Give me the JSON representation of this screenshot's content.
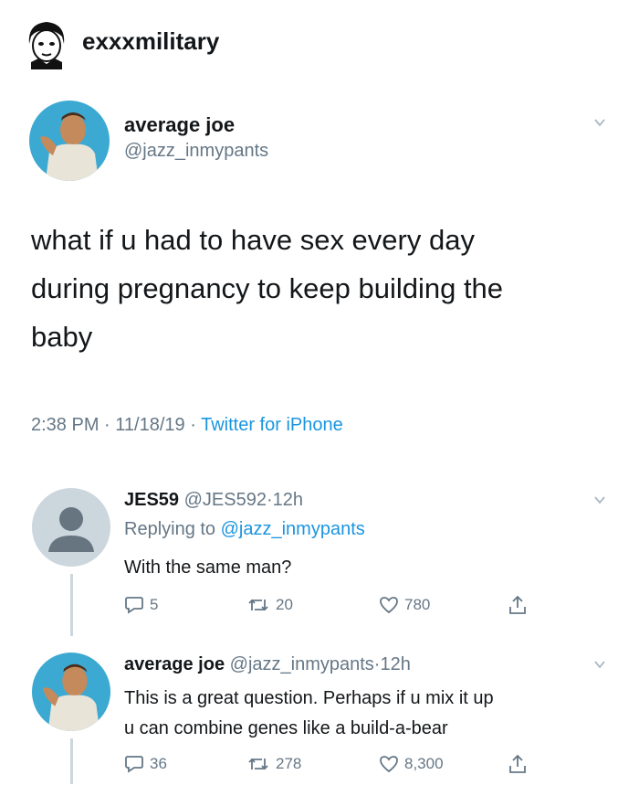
{
  "poster": {
    "username": "exxxmilitary",
    "avatar_icon": "cartoon-face-icon"
  },
  "main_tweet": {
    "display_name": "average joe",
    "handle": "@jazz_inmypants",
    "text_lines": [
      "what if u had to have sex every day",
      "during pregnancy to keep building the",
      "baby"
    ],
    "time": "2:38 PM",
    "date": "11/18/19",
    "source": "Twitter for iPhone",
    "dot": "·"
  },
  "replies": [
    {
      "display_name": "JES59",
      "handle": "@JES592",
      "age": "12h",
      "replying_prefix": "Replying to",
      "replying_to": "@jazz_inmypants",
      "text_lines": [
        "With the same man?"
      ],
      "counts": {
        "replies": "5",
        "retweets": "20",
        "likes": "780"
      }
    },
    {
      "display_name": "average joe",
      "handle": "@jazz_inmypants",
      "age": "12h",
      "text_lines": [
        "This is a great question. Perhaps if u mix it up",
        "u can combine genes like a build-a-bear"
      ],
      "counts": {
        "replies": "36",
        "retweets": "278",
        "likes": "8,300"
      }
    }
  ],
  "colors": {
    "link": "#1b95e0",
    "muted": "#657786",
    "avatar_bg": "#3ba9d1",
    "default_avatar_bg": "#ccd6dd"
  }
}
